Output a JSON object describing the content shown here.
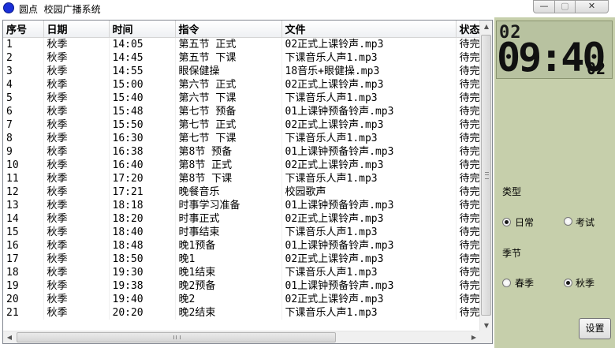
{
  "window": {
    "title": "圆点  校园广播系统",
    "buttons": {
      "minimize": "—",
      "maximize": "▢",
      "close": "✕"
    }
  },
  "table": {
    "columns": [
      "序号",
      "日期",
      "时间",
      "指令",
      "文件",
      "状态"
    ],
    "rows": [
      [
        "1",
        "秋季",
        "14:05",
        "第五节 正式",
        "02正式上课铃声.mp3",
        "待完"
      ],
      [
        "2",
        "秋季",
        "14:45",
        "第五节 下课",
        "下课音乐人声1.mp3",
        "待完"
      ],
      [
        "3",
        "秋季",
        "14:55",
        "眼保健操",
        "18音乐+眼健操.mp3",
        "待完"
      ],
      [
        "4",
        "秋季",
        "15:00",
        "第六节 正式",
        "02正式上课铃声.mp3",
        "待完"
      ],
      [
        "5",
        "秋季",
        "15:40",
        "第六节 下课",
        "下课音乐人声1.mp3",
        "待完"
      ],
      [
        "6",
        "秋季",
        "15:48",
        "第七节 预备",
        "01上课钟预备铃声.mp3",
        "待完"
      ],
      [
        "7",
        "秋季",
        "15:50",
        "第七节 正式",
        "02正式上课铃声.mp3",
        "待完"
      ],
      [
        "8",
        "秋季",
        "16:30",
        "第七节 下课",
        "下课音乐人声1.mp3",
        "待完"
      ],
      [
        "9",
        "秋季",
        "16:38",
        "第8节 预备",
        "01上课钟预备铃声.mp3",
        "待完"
      ],
      [
        "10",
        "秋季",
        "16:40",
        "第8节 正式",
        "02正式上课铃声.mp3",
        "待完"
      ],
      [
        "11",
        "秋季",
        "17:20",
        "第8节 下课",
        "下课音乐人声1.mp3",
        "待完"
      ],
      [
        "12",
        "秋季",
        "17:21",
        "晚餐音乐",
        "校园歌声",
        "待完"
      ],
      [
        "13",
        "秋季",
        "18:18",
        "时事学习准备",
        "01上课钟预备铃声.mp3",
        "待完"
      ],
      [
        "14",
        "秋季",
        "18:20",
        "时事正式",
        "02正式上课铃声.mp3",
        "待完"
      ],
      [
        "15",
        "秋季",
        "18:40",
        "时事结束",
        "下课音乐人声1.mp3",
        "待完"
      ],
      [
        "16",
        "秋季",
        "18:48",
        "晚1预备",
        "01上课钟预备铃声.mp3",
        "待完"
      ],
      [
        "17",
        "秋季",
        "18:50",
        "晚1",
        "02正式上课铃声.mp3",
        "待完"
      ],
      [
        "18",
        "秋季",
        "19:30",
        "晚1结束",
        "下课音乐人声1.mp3",
        "待完"
      ],
      [
        "19",
        "秋季",
        "19:38",
        "晚2预备",
        "01上课钟预备铃声.mp3",
        "待完"
      ],
      [
        "20",
        "秋季",
        "19:40",
        "晚2",
        "02正式上课铃声.mp3",
        "待完"
      ],
      [
        "21",
        "秋季",
        "20:20",
        "晚2结束",
        "下课音乐人声1.mp3",
        "待完"
      ]
    ]
  },
  "clock": {
    "day": "02",
    "hours_minutes": "09:40",
    "seconds": "02"
  },
  "panel": {
    "type_label": "类型",
    "type_options": [
      {
        "label": "日常",
        "checked": true
      },
      {
        "label": "考试",
        "checked": false
      }
    ],
    "season_label": "季节",
    "season_options": [
      {
        "label": "春季",
        "checked": false
      },
      {
        "label": "秋季",
        "checked": true
      }
    ],
    "settings_button": "设置"
  },
  "colors": {
    "panel_bg": "#c6cfab",
    "lcd_bg": "#b8c2a0",
    "app_icon": "#1a2fd8"
  }
}
